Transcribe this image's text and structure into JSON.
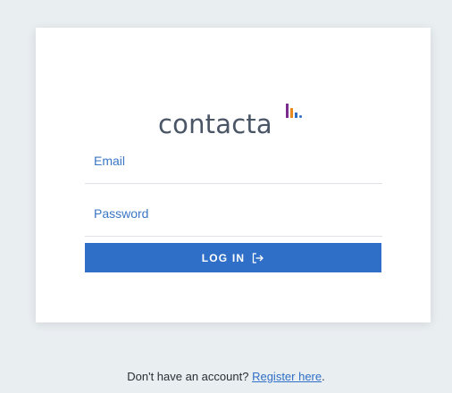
{
  "brand": {
    "name": "contacta",
    "colors": {
      "purple": "#7b2d8e",
      "orange": "#e8891e",
      "blue": "#2f6fc7"
    }
  },
  "login_form": {
    "email_placeholder": "Email",
    "password_placeholder": "Password",
    "submit_label": "LOG IN",
    "submit_icon": "logout-arrow-icon"
  },
  "footer": {
    "prompt": "Don't have an account?",
    "register_link": "Register here",
    "suffix": "."
  },
  "colors": {
    "background": "#e9eef1",
    "accent": "#2f6fc7",
    "card": "#ffffff"
  }
}
